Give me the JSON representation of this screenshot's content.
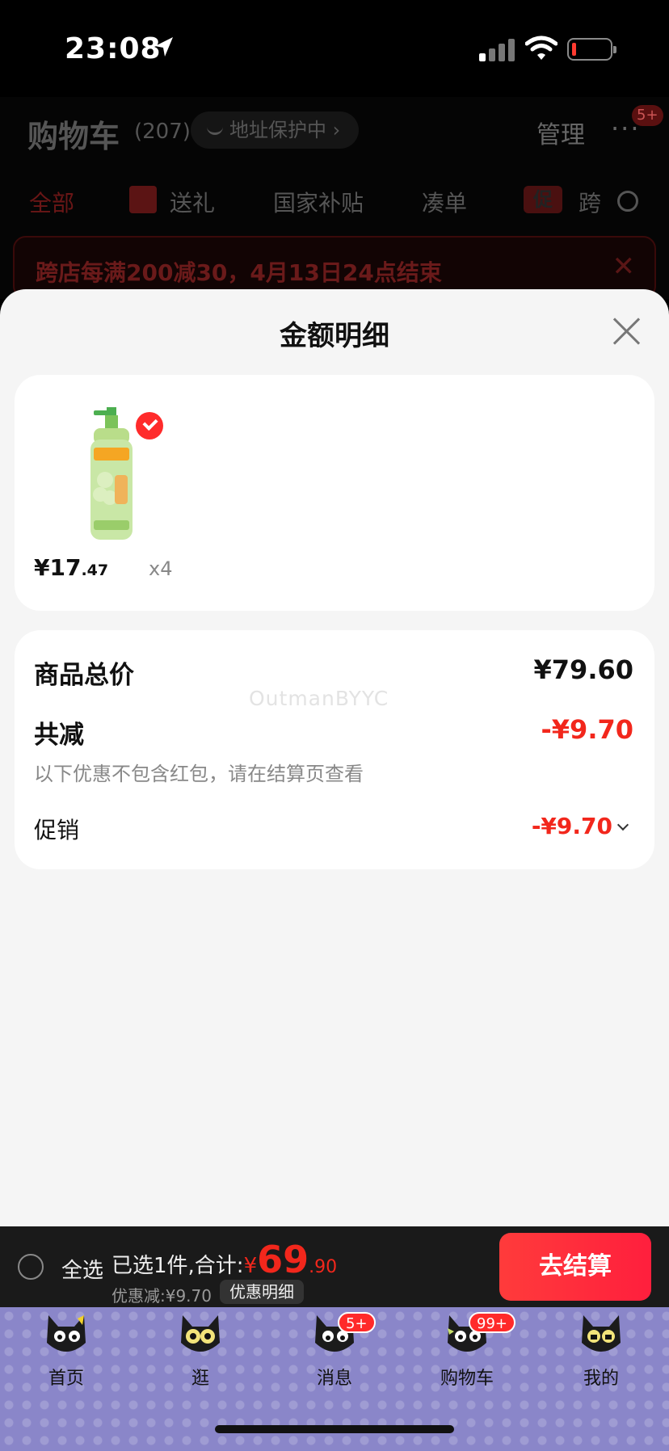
{
  "status_bar": {
    "time": "23:08"
  },
  "background_page": {
    "title": "购物车",
    "count": "(207)",
    "address_chip": "地址保护中 ›",
    "manage": "管理",
    "more": "···",
    "more_badge": "5+",
    "tabs": [
      "全部",
      "送礼",
      "国家补贴",
      "凑单",
      "跨"
    ],
    "promo_tag": "促",
    "banner": "跨店每满200减30，4月13日24点结束",
    "banner_close": "✕"
  },
  "sheet": {
    "title": "金额明细",
    "product": {
      "price_int": "¥17",
      "price_dec": ".47",
      "quantity": "x4",
      "selected": true
    },
    "summary": {
      "total_label": "商品总价",
      "total_value": "¥79.60",
      "discount_label": "共减",
      "discount_value": "-¥9.70",
      "note": "以下优惠不包含红包，请在结算页查看",
      "promo_label": "促销",
      "promo_value": "-¥9.70"
    },
    "watermark": "OutmanBYYC"
  },
  "checkout": {
    "select_all": "全选",
    "selected_text": "已选1件,合计:",
    "currency": "¥",
    "total_int": "69",
    "total_dec": ".90",
    "discount_text": "优惠减:¥9.70",
    "detail_button": "优惠明细",
    "pay_button": "去结算"
  },
  "tabbar": [
    {
      "label": "首页",
      "badge": ""
    },
    {
      "label": "逛",
      "badge": ""
    },
    {
      "label": "消息",
      "badge": "5+"
    },
    {
      "label": "购物车",
      "badge": "99+"
    },
    {
      "label": "我的",
      "badge": ""
    }
  ],
  "colors": {
    "accent": "#f2271c",
    "tabbar": "#8a86c9"
  }
}
